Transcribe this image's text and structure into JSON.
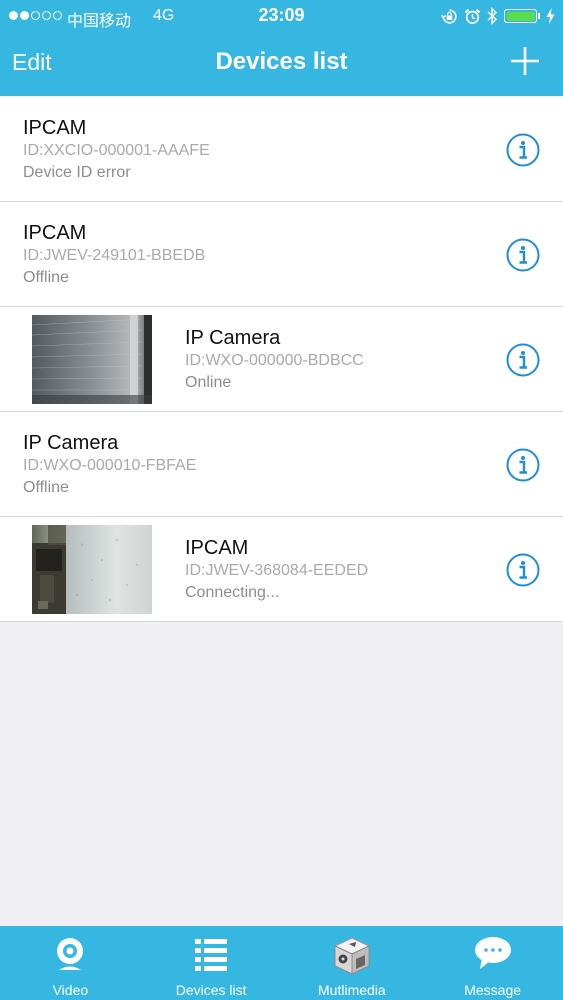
{
  "status_bar": {
    "carrier": "中国移动",
    "network": "4G",
    "time": "23:09",
    "battery_level": 1.0
  },
  "nav": {
    "edit_label": "Edit",
    "title": "Devices list",
    "add_icon": "plus-icon"
  },
  "devices": [
    {
      "name": "IPCAM",
      "id": "ID:XXCIO-000001-AAAFE",
      "status": "Device ID error",
      "has_thumbnail": false
    },
    {
      "name": "IPCAM",
      "id": "ID:JWEV-249101-BBEDB",
      "status": "Offline",
      "has_thumbnail": false
    },
    {
      "name": "IP Camera",
      "id": "ID:WXO-000000-BDBCC",
      "status": "Online",
      "has_thumbnail": true
    },
    {
      "name": "IP Camera",
      "id": "ID:WXO-000010-FBFAE",
      "status": "Offline",
      "has_thumbnail": false
    },
    {
      "name": "IPCAM",
      "id": "ID:JWEV-368084-EEDED",
      "status": "Connecting...",
      "has_thumbnail": true
    }
  ],
  "tabs": [
    {
      "label": "Video",
      "icon": "webcam-icon"
    },
    {
      "label": "Devices list",
      "icon": "list-icon"
    },
    {
      "label": "Mutlimedia",
      "icon": "media-box-icon"
    },
    {
      "label": "Message",
      "icon": "chat-bubble-icon"
    }
  ],
  "colors": {
    "accent": "#36b7e1",
    "info_icon": "#1e8fd6",
    "battery": "#5bdc4c",
    "background": "#efeff4"
  }
}
